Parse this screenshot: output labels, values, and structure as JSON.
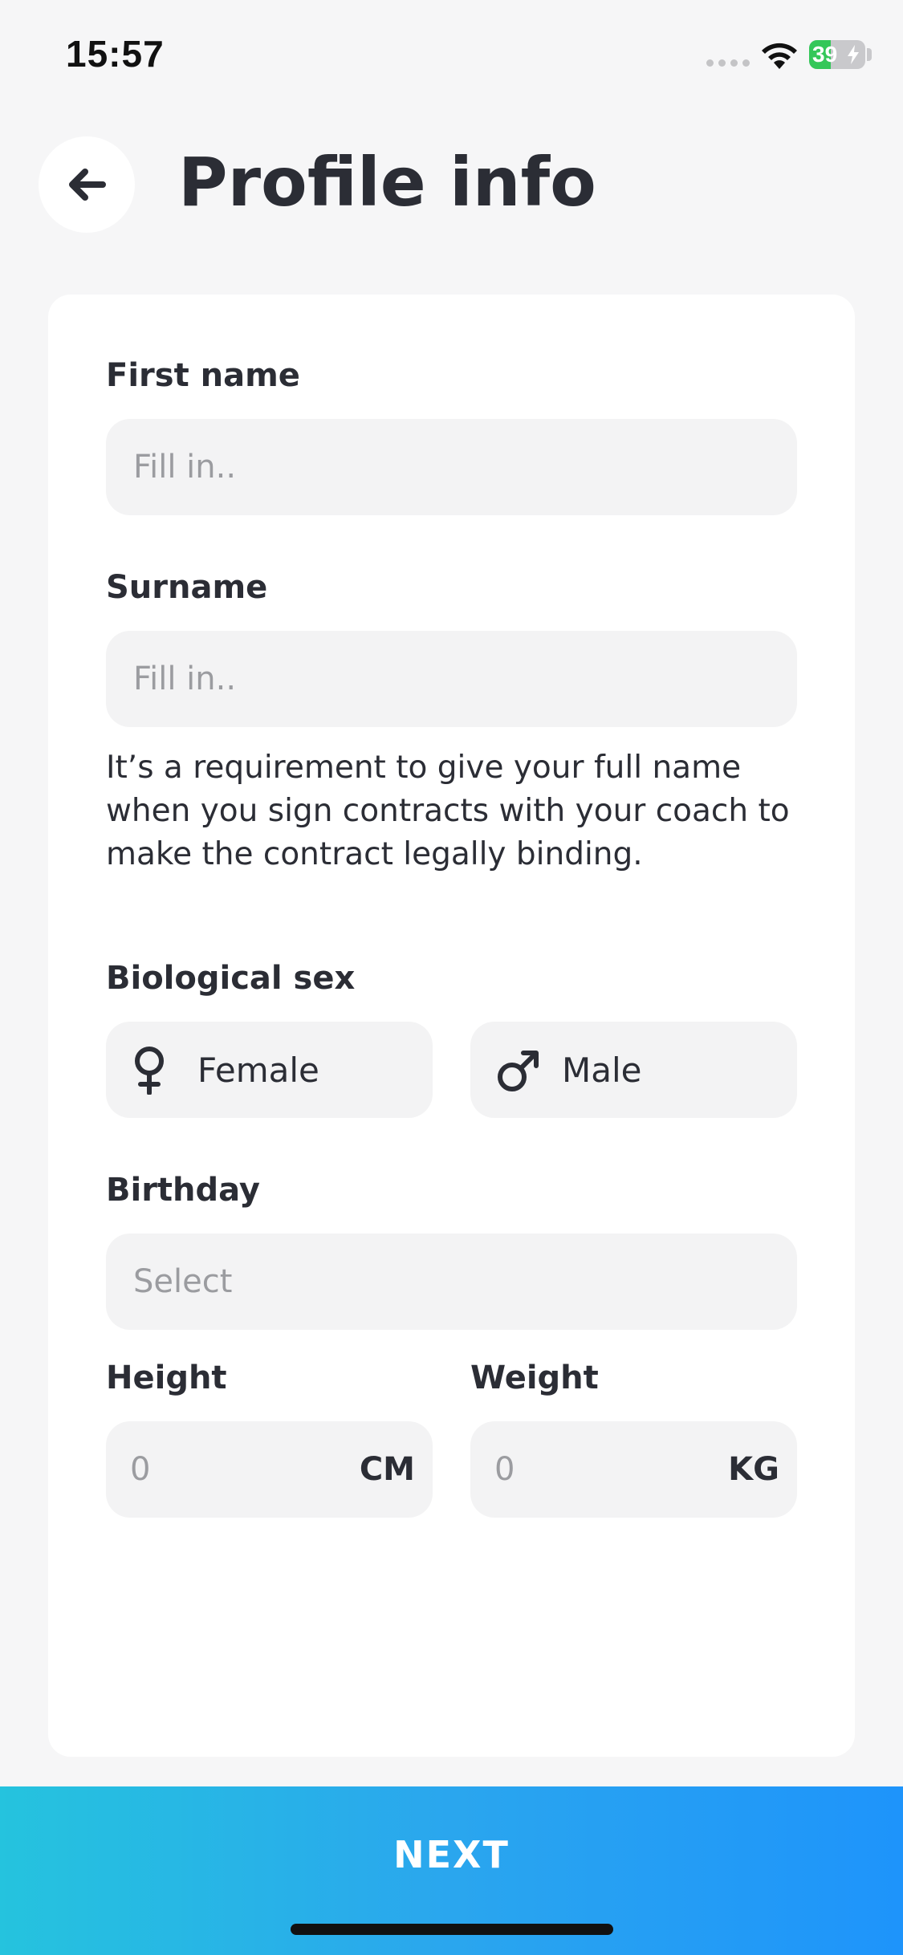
{
  "status_bar": {
    "time": "15:57",
    "battery_percent": "39",
    "battery_level": 0.39,
    "icons": [
      "signal-dots-icon",
      "wifi-icon",
      "battery-icon",
      "charging-bolt-icon"
    ]
  },
  "header": {
    "back_icon": "arrow-left-icon",
    "title": "Profile info"
  },
  "form": {
    "first_name": {
      "label": "First name",
      "placeholder": "Fill in..",
      "value": ""
    },
    "surname": {
      "label": "Surname",
      "placeholder": "Fill in..",
      "value": ""
    },
    "helper_text": "It’s a requirement to give your full name when you sign contracts with your coach to make the contract legally binding.",
    "biological_sex": {
      "label": "Biological sex",
      "options": [
        {
          "label": "Female",
          "icon": "female-symbol-icon"
        },
        {
          "label": "Male",
          "icon": "male-symbol-icon"
        }
      ]
    },
    "birthday": {
      "label": "Birthday",
      "placeholder": "Select"
    },
    "height": {
      "label": "Height",
      "placeholder": "0",
      "unit": "CM"
    },
    "weight": {
      "label": "Weight",
      "placeholder": "0",
      "unit": "KG"
    }
  },
  "footer": {
    "next_label": "NEXT"
  },
  "colors": {
    "background": "#f6f6f7",
    "card": "#ffffff",
    "input": "#f3f3f4",
    "text": "#2b2d35",
    "placeholder": "#9b9ca0",
    "button_gradient_start": "#25c3de",
    "button_gradient_end": "#1e94fb",
    "battery_green": "#34c759"
  }
}
